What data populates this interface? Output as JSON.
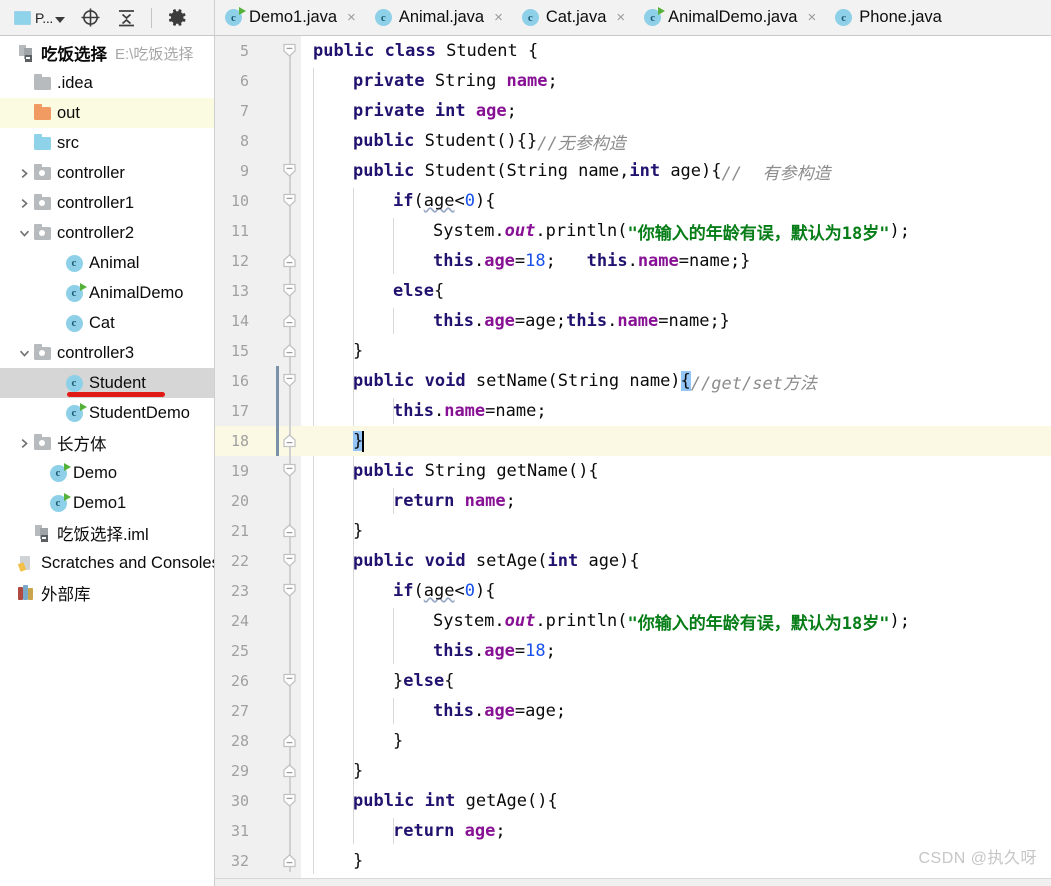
{
  "toolbar": {
    "project_label": "P...",
    "project_icon": "project-window-icon",
    "locate_icon": "locate-target-icon",
    "collapse_icon": "collapse-all-icon",
    "settings_icon": "gear-icon"
  },
  "tabs": [
    {
      "label": "Demo1.java",
      "icon": "java-class-runnable-icon",
      "runnable": true,
      "close": "×"
    },
    {
      "label": "Animal.java",
      "icon": "java-class-icon",
      "runnable": false,
      "close": "×"
    },
    {
      "label": "Cat.java",
      "icon": "java-class-icon",
      "runnable": false,
      "close": "×"
    },
    {
      "label": "AnimalDemo.java",
      "icon": "java-class-runnable-icon",
      "runnable": true,
      "close": "×"
    },
    {
      "label": "Phone.java",
      "icon": "java-class-icon",
      "runnable": false,
      "close": ""
    }
  ],
  "sidebar": {
    "root": {
      "name": "吃饭选择",
      "path": "E:\\吃饭选择"
    },
    "items": [
      {
        "label": ".idea",
        "icon": "folder-grey-icon",
        "indent": 1,
        "arrow": "none",
        "state": "normal"
      },
      {
        "label": "out",
        "icon": "folder-orange-icon",
        "indent": 1,
        "arrow": "none",
        "state": "highlighted"
      },
      {
        "label": "src",
        "icon": "folder-blue-icon",
        "indent": 1,
        "arrow": "none",
        "state": "normal"
      },
      {
        "label": "controller",
        "icon": "package-icon",
        "indent": 1,
        "arrow": "collapsed",
        "state": "normal"
      },
      {
        "label": "controller1",
        "icon": "package-icon",
        "indent": 1,
        "arrow": "collapsed",
        "state": "normal"
      },
      {
        "label": "controller2",
        "icon": "package-icon",
        "indent": 1,
        "arrow": "expanded",
        "state": "normal"
      },
      {
        "label": "Animal",
        "icon": "java-class-icon",
        "indent": 3,
        "arrow": "none",
        "state": "normal"
      },
      {
        "label": "AnimalDemo",
        "icon": "java-class-runnable-icon",
        "indent": 3,
        "arrow": "none",
        "state": "normal"
      },
      {
        "label": "Cat",
        "icon": "java-class-icon",
        "indent": 3,
        "arrow": "none",
        "state": "normal"
      },
      {
        "label": "controller3",
        "icon": "package-icon",
        "indent": 1,
        "arrow": "expanded",
        "state": "normal"
      },
      {
        "label": "Student",
        "icon": "java-class-icon",
        "indent": 3,
        "arrow": "none",
        "state": "selected"
      },
      {
        "label": "StudentDemo",
        "icon": "java-class-runnable-icon",
        "indent": 3,
        "arrow": "none",
        "state": "normal"
      },
      {
        "label": "长方体",
        "icon": "package-icon",
        "indent": 1,
        "arrow": "collapsed",
        "state": "normal"
      },
      {
        "label": "Demo",
        "icon": "java-class-runnable-icon",
        "indent": 2,
        "arrow": "none",
        "state": "normal"
      },
      {
        "label": "Demo1",
        "icon": "java-class-runnable-icon",
        "indent": 2,
        "arrow": "none",
        "state": "normal"
      },
      {
        "label": "吃饭选择.iml",
        "icon": "iml-module-icon",
        "indent": 1,
        "arrow": "none",
        "state": "normal"
      },
      {
        "label": "Scratches and Consoles",
        "icon": "scratches-icon",
        "indent": 0,
        "arrow": "none",
        "state": "normal"
      },
      {
        "label": "外部库",
        "icon": "external-libraries-icon",
        "indent": 0,
        "arrow": "none",
        "state": "normal"
      }
    ]
  },
  "editor": {
    "first_line": 5,
    "current_line": 18,
    "lines": [
      {
        "n": 5,
        "indent": 1,
        "fold": "start",
        "tokens": [
          {
            "t": "public ",
            "c": "kw"
          },
          {
            "t": "class ",
            "c": "kw"
          },
          {
            "t": "Student {",
            "c": "plain"
          }
        ]
      },
      {
        "n": 6,
        "indent": 2,
        "fold": "none",
        "tokens": [
          {
            "t": "private ",
            "c": "kw"
          },
          {
            "t": "String ",
            "c": "plain"
          },
          {
            "t": "name",
            "c": "fld"
          },
          {
            "t": ";",
            "c": "plain"
          }
        ]
      },
      {
        "n": 7,
        "indent": 2,
        "fold": "none",
        "tokens": [
          {
            "t": "private ",
            "c": "kw"
          },
          {
            "t": "int ",
            "c": "kw"
          },
          {
            "t": "age",
            "c": "fld"
          },
          {
            "t": ";",
            "c": "plain"
          }
        ]
      },
      {
        "n": 8,
        "indent": 2,
        "fold": "none",
        "tokens": [
          {
            "t": "public ",
            "c": "kw"
          },
          {
            "t": "Student(){}",
            "c": "plain"
          },
          {
            "t": "//无参构造",
            "c": "cmt"
          }
        ]
      },
      {
        "n": 9,
        "indent": 2,
        "fold": "start",
        "tokens": [
          {
            "t": "public ",
            "c": "kw"
          },
          {
            "t": "Student(String name,",
            "c": "plain"
          },
          {
            "t": "int ",
            "c": "kw"
          },
          {
            "t": "age){",
            "c": "plain"
          },
          {
            "t": "//  有参构造",
            "c": "cmt"
          }
        ]
      },
      {
        "n": 10,
        "indent": 3,
        "fold": "start",
        "tokens": [
          {
            "t": "if",
            "c": "kw"
          },
          {
            "t": "(",
            "c": "plain"
          },
          {
            "t": "age",
            "c": "squiggle"
          },
          {
            "t": "<",
            "c": "plain"
          },
          {
            "t": "0",
            "c": "num"
          },
          {
            "t": "){",
            "c": "plain"
          }
        ]
      },
      {
        "n": 11,
        "indent": 4,
        "fold": "none",
        "tokens": [
          {
            "t": "System.",
            "c": "plain"
          },
          {
            "t": "out",
            "c": "stat"
          },
          {
            "t": ".println(",
            "c": "plain"
          },
          {
            "t": "\"你输入的年龄有误，默认为18岁\"",
            "c": "str"
          },
          {
            "t": ");",
            "c": "plain"
          }
        ]
      },
      {
        "n": 12,
        "indent": 4,
        "fold": "end",
        "tokens": [
          {
            "t": "this",
            "c": "kw"
          },
          {
            "t": ".",
            "c": "plain"
          },
          {
            "t": "age",
            "c": "fld"
          },
          {
            "t": "=",
            "c": "plain"
          },
          {
            "t": "18",
            "c": "num"
          },
          {
            "t": ";   ",
            "c": "plain"
          },
          {
            "t": "this",
            "c": "kw"
          },
          {
            "t": ".",
            "c": "plain"
          },
          {
            "t": "name",
            "c": "fld"
          },
          {
            "t": "=name;}",
            "c": "plain"
          }
        ]
      },
      {
        "n": 13,
        "indent": 3,
        "fold": "start",
        "tokens": [
          {
            "t": "else",
            "c": "kw"
          },
          {
            "t": "{",
            "c": "plain"
          }
        ]
      },
      {
        "n": 14,
        "indent": 4,
        "fold": "end",
        "tokens": [
          {
            "t": "this",
            "c": "kw"
          },
          {
            "t": ".",
            "c": "plain"
          },
          {
            "t": "age",
            "c": "fld"
          },
          {
            "t": "=age;",
            "c": "plain"
          },
          {
            "t": "this",
            "c": "kw"
          },
          {
            "t": ".",
            "c": "plain"
          },
          {
            "t": "name",
            "c": "fld"
          },
          {
            "t": "=name;}",
            "c": "plain"
          }
        ]
      },
      {
        "n": 15,
        "indent": 2,
        "fold": "end",
        "tokens": [
          {
            "t": "}",
            "c": "plain"
          }
        ]
      },
      {
        "n": 16,
        "indent": 2,
        "fold": "start",
        "tokens": [
          {
            "t": "public ",
            "c": "kw"
          },
          {
            "t": "void ",
            "c": "kw"
          },
          {
            "t": "setName(String name)",
            "c": "plain"
          },
          {
            "t": "{",
            "c": "brace-hl"
          },
          {
            "t": "//get/set方法",
            "c": "cmt"
          }
        ]
      },
      {
        "n": 17,
        "indent": 3,
        "fold": "none",
        "tokens": [
          {
            "t": "this",
            "c": "kw"
          },
          {
            "t": ".",
            "c": "plain"
          },
          {
            "t": "name",
            "c": "fld"
          },
          {
            "t": "=name;",
            "c": "plain"
          }
        ]
      },
      {
        "n": 18,
        "indent": 2,
        "fold": "end",
        "caret": true,
        "tokens": [
          {
            "t": "}",
            "c": "brace-hl"
          }
        ]
      },
      {
        "n": 19,
        "indent": 2,
        "fold": "start",
        "tokens": [
          {
            "t": "public ",
            "c": "kw"
          },
          {
            "t": "String ",
            "c": "plain"
          },
          {
            "t": "getName(){",
            "c": "plain"
          }
        ]
      },
      {
        "n": 20,
        "indent": 3,
        "fold": "none",
        "tokens": [
          {
            "t": "return ",
            "c": "kw"
          },
          {
            "t": "name",
            "c": "fld"
          },
          {
            "t": ";",
            "c": "plain"
          }
        ]
      },
      {
        "n": 21,
        "indent": 2,
        "fold": "end",
        "tokens": [
          {
            "t": "}",
            "c": "plain"
          }
        ]
      },
      {
        "n": 22,
        "indent": 2,
        "fold": "start",
        "tokens": [
          {
            "t": "public ",
            "c": "kw"
          },
          {
            "t": "void ",
            "c": "kw"
          },
          {
            "t": "setAge(",
            "c": "plain"
          },
          {
            "t": "int ",
            "c": "kw"
          },
          {
            "t": "age){",
            "c": "plain"
          }
        ]
      },
      {
        "n": 23,
        "indent": 3,
        "fold": "start",
        "tokens": [
          {
            "t": "if",
            "c": "kw"
          },
          {
            "t": "(",
            "c": "plain"
          },
          {
            "t": "age",
            "c": "squiggle"
          },
          {
            "t": "<",
            "c": "plain"
          },
          {
            "t": "0",
            "c": "num"
          },
          {
            "t": "){",
            "c": "plain"
          }
        ]
      },
      {
        "n": 24,
        "indent": 4,
        "fold": "none",
        "tokens": [
          {
            "t": "System.",
            "c": "plain"
          },
          {
            "t": "out",
            "c": "stat"
          },
          {
            "t": ".println(",
            "c": "plain"
          },
          {
            "t": "\"你输入的年龄有误，默认为18岁\"",
            "c": "str"
          },
          {
            "t": ");",
            "c": "plain"
          }
        ]
      },
      {
        "n": 25,
        "indent": 4,
        "fold": "none",
        "tokens": [
          {
            "t": "this",
            "c": "kw"
          },
          {
            "t": ".",
            "c": "plain"
          },
          {
            "t": "age",
            "c": "fld"
          },
          {
            "t": "=",
            "c": "plain"
          },
          {
            "t": "18",
            "c": "num"
          },
          {
            "t": ";",
            "c": "plain"
          }
        ]
      },
      {
        "n": 26,
        "indent": 3,
        "fold": "start",
        "tokens": [
          {
            "t": "}",
            "c": "plain"
          },
          {
            "t": "else",
            "c": "kw"
          },
          {
            "t": "{",
            "c": "plain"
          }
        ]
      },
      {
        "n": 27,
        "indent": 4,
        "fold": "none",
        "tokens": [
          {
            "t": "this",
            "c": "kw"
          },
          {
            "t": ".",
            "c": "plain"
          },
          {
            "t": "age",
            "c": "fld"
          },
          {
            "t": "=age;",
            "c": "plain"
          }
        ]
      },
      {
        "n": 28,
        "indent": 3,
        "fold": "end",
        "tokens": [
          {
            "t": "}",
            "c": "plain"
          }
        ]
      },
      {
        "n": 29,
        "indent": 2,
        "fold": "end",
        "tokens": [
          {
            "t": "}",
            "c": "plain"
          }
        ]
      },
      {
        "n": 30,
        "indent": 2,
        "fold": "start",
        "tokens": [
          {
            "t": "public ",
            "c": "kw"
          },
          {
            "t": "int ",
            "c": "kw"
          },
          {
            "t": "getAge(){",
            "c": "plain"
          }
        ]
      },
      {
        "n": 31,
        "indent": 3,
        "fold": "none",
        "tokens": [
          {
            "t": "return ",
            "c": "kw"
          },
          {
            "t": "age",
            "c": "fld"
          },
          {
            "t": ";",
            "c": "plain"
          }
        ]
      },
      {
        "n": 32,
        "indent": 2,
        "fold": "end",
        "tokens": [
          {
            "t": "}",
            "c": "plain"
          }
        ]
      }
    ]
  },
  "watermark": "CSDN @执久呀",
  "colors": {
    "keyword": "#20126e",
    "field": "#871094",
    "string": "#067d17",
    "number": "#1750eb",
    "comment": "#8c8c8c",
    "selection": "#d6d6d6",
    "current_line": "#fbf8e3",
    "brace_highlight": "#93c5f7",
    "underline_annotation": "#e01b15"
  }
}
